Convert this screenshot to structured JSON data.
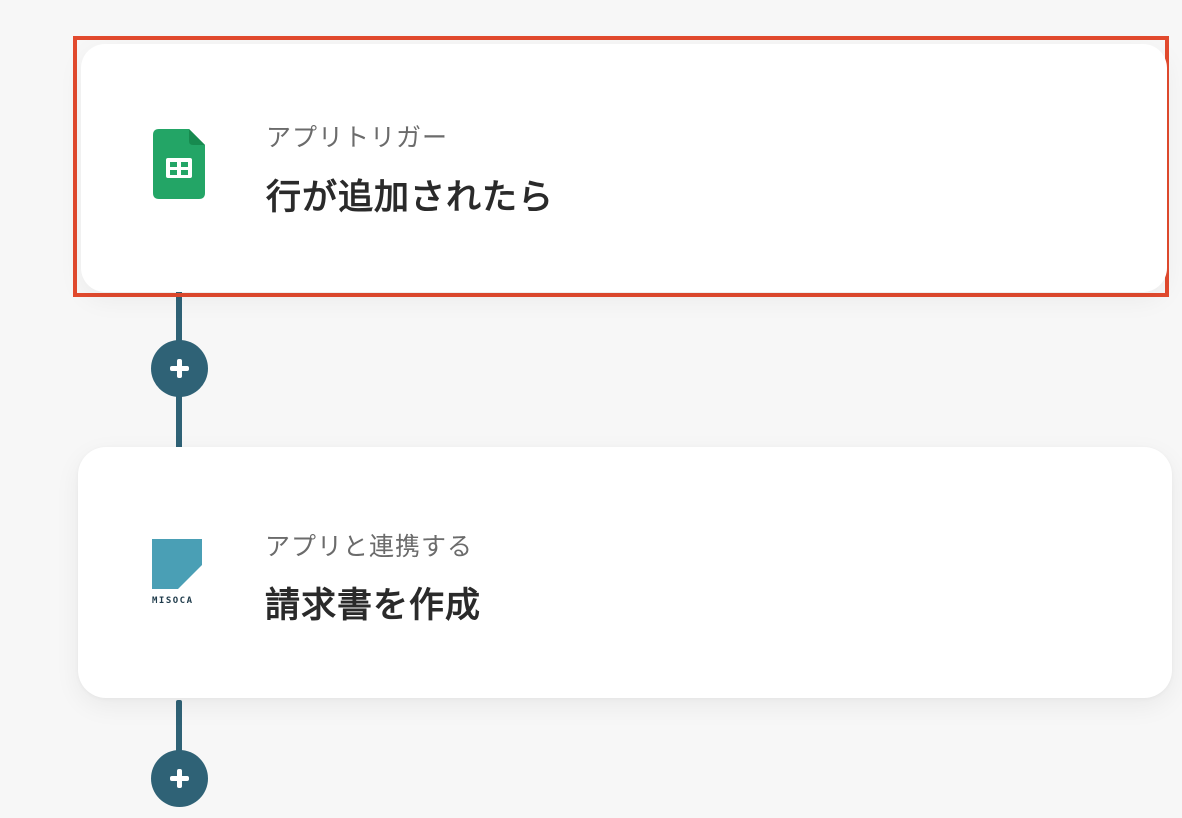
{
  "steps": [
    {
      "subtitle": "アプリトリガー",
      "title": "行が追加されたら",
      "app_icon": "google-sheets-icon",
      "selected": true
    },
    {
      "subtitle": "アプリと連携する",
      "title": "請求書を作成",
      "app_icon": "misoca-icon",
      "app_icon_text": "MISOCA",
      "selected": false
    }
  ],
  "colors": {
    "background": "#f7f7f7",
    "connector": "#2f6276",
    "highlight_border": "#e24a2e",
    "sheets_green": "#23a566",
    "misoca_blue": "#4a9fb5"
  },
  "icons": {
    "add_step": "plus-icon"
  }
}
